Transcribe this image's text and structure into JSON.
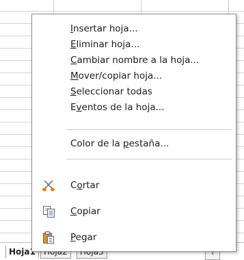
{
  "sheet_tabs": [
    {
      "label": "Hoja1",
      "active": true
    },
    {
      "label": "Hoja2",
      "active": false
    },
    {
      "label": "Hoja3",
      "active": false
    }
  ],
  "context_menu": {
    "items": [
      {
        "label": "Insertar hoja...",
        "accel": "I"
      },
      {
        "label": "Eliminar hoja...",
        "accel": "E"
      },
      {
        "label": "Cambiar nombre a la hoja...",
        "accel": "C"
      },
      {
        "label": "Mover/copiar hoja...",
        "accel": "M"
      },
      {
        "label": "Seleccionar todas",
        "accel": "S"
      },
      {
        "label": "Eventos de la hoja...",
        "accel": "v"
      },
      {
        "label": "Color de la pestaña...",
        "accel": "p"
      },
      {
        "label": "Cortar",
        "accel": "o",
        "icon": "scissors-icon"
      },
      {
        "label": "Copiar",
        "accel": "C",
        "icon": "copy-icon"
      },
      {
        "label": "Pegar",
        "accel": "P",
        "icon": "paste-icon"
      }
    ]
  },
  "scroll": {
    "arrow": "‹"
  },
  "colors": {
    "menu_border": "#8f8f8f",
    "separator": "#c8c8c8",
    "scissors": "#e07a1f"
  }
}
